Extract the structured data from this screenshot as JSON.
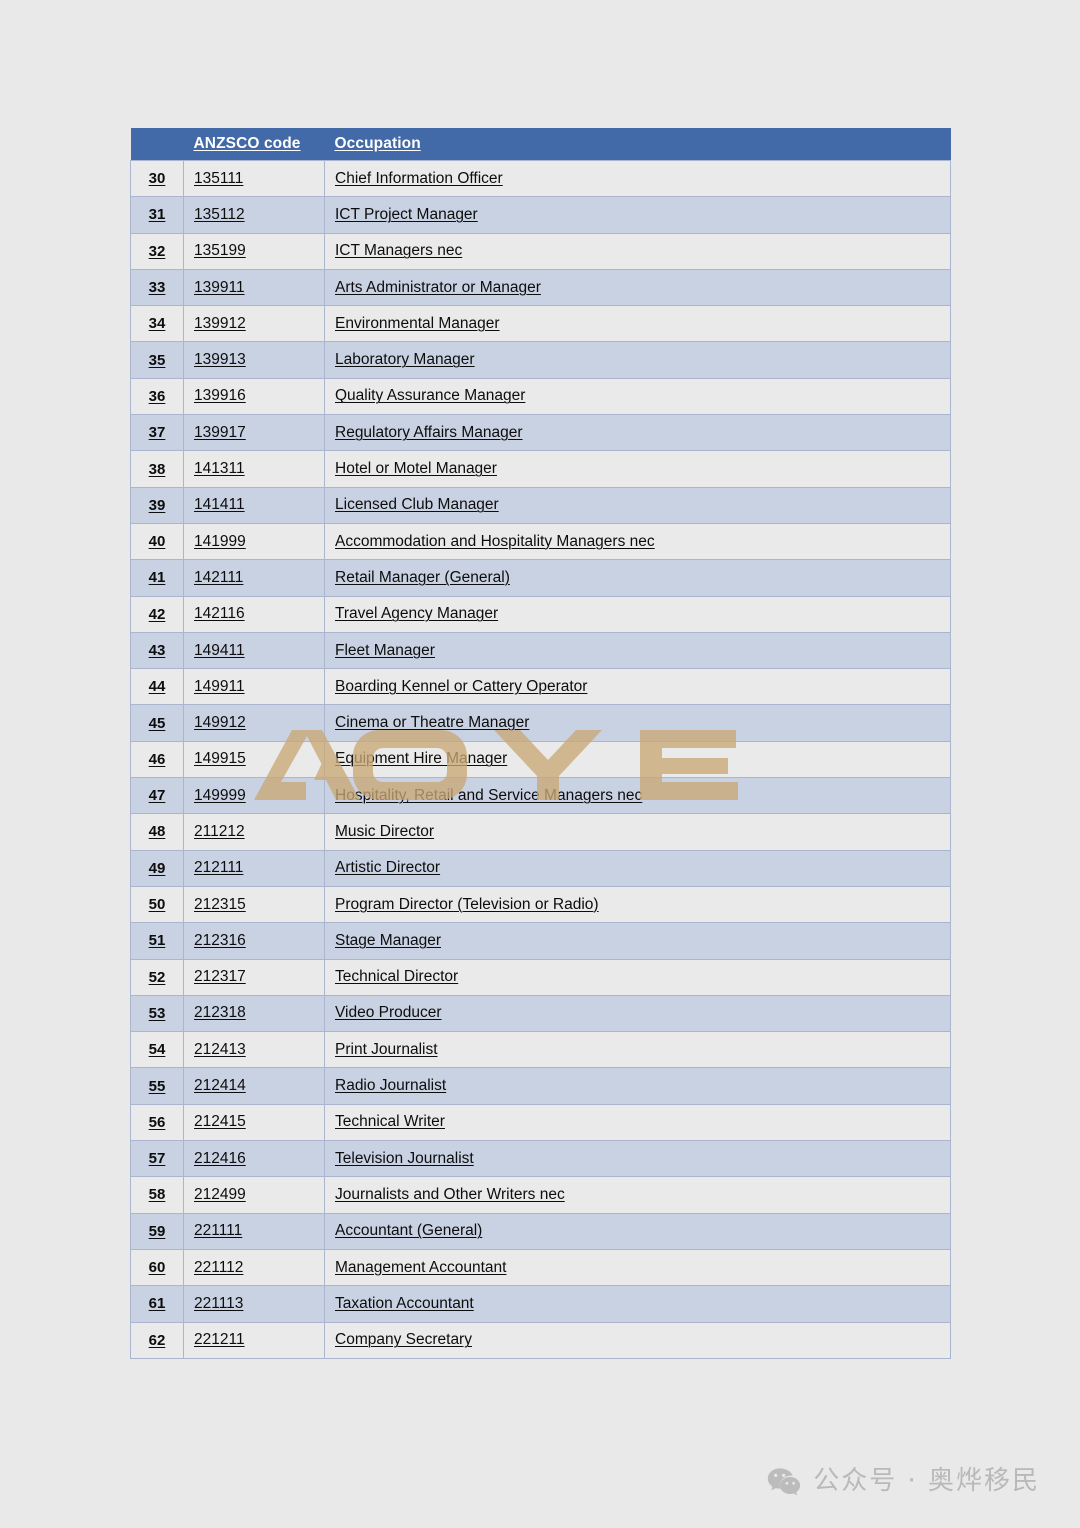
{
  "table": {
    "columns": [
      "",
      "ANZSCO code",
      "Occupation"
    ],
    "header": {
      "num_label": "",
      "code_label": "ANZSCO code",
      "occupation_label": "Occupation"
    },
    "rows": [
      {
        "num": "30",
        "code": "135111",
        "occupation": "Chief Information Officer"
      },
      {
        "num": "31",
        "code": "135112",
        "occupation": "ICT Project Manager"
      },
      {
        "num": "32",
        "code": "135199",
        "occupation": "ICT Managers nec"
      },
      {
        "num": "33",
        "code": "139911",
        "occupation": "Arts Administrator or Manager"
      },
      {
        "num": "34",
        "code": "139912",
        "occupation": "Environmental Manager"
      },
      {
        "num": "35",
        "code": "139913",
        "occupation": "Laboratory Manager"
      },
      {
        "num": "36",
        "code": "139916",
        "occupation": "Quality Assurance Manager"
      },
      {
        "num": "37",
        "code": "139917",
        "occupation": "Regulatory Affairs Manager"
      },
      {
        "num": "38",
        "code": "141311",
        "occupation": "Hotel or Motel Manager"
      },
      {
        "num": "39",
        "code": "141411",
        "occupation": "Licensed Club Manager"
      },
      {
        "num": "40",
        "code": "141999",
        "occupation": "Accommodation and Hospitality Managers nec"
      },
      {
        "num": "41",
        "code": "142111",
        "occupation": "Retail Manager (General)"
      },
      {
        "num": "42",
        "code": "142116",
        "occupation": "Travel Agency Manager"
      },
      {
        "num": "43",
        "code": "149411",
        "occupation": "Fleet Manager"
      },
      {
        "num": "44",
        "code": "149911",
        "occupation": "Boarding Kennel or Cattery Operator"
      },
      {
        "num": "45",
        "code": "149912",
        "occupation": "Cinema or Theatre Manager"
      },
      {
        "num": "46",
        "code": "149915",
        "occupation": "Equipment Hire Manager"
      },
      {
        "num": "47",
        "code": "149999",
        "occupation": "Hospitality, Retail and Service Managers nec"
      },
      {
        "num": "48",
        "code": "211212",
        "occupation": "Music Director"
      },
      {
        "num": "49",
        "code": "212111",
        "occupation": "Artistic Director"
      },
      {
        "num": "50",
        "code": "212315",
        "occupation": "Program Director (Television or Radio)"
      },
      {
        "num": "51",
        "code": "212316",
        "occupation": "Stage Manager"
      },
      {
        "num": "52",
        "code": "212317",
        "occupation": "Technical Director"
      },
      {
        "num": "53",
        "code": "212318",
        "occupation": "Video Producer"
      },
      {
        "num": "54",
        "code": "212413",
        "occupation": "Print Journalist"
      },
      {
        "num": "55",
        "code": "212414",
        "occupation": "Radio Journalist"
      },
      {
        "num": "56",
        "code": "212415",
        "occupation": "Technical Writer"
      },
      {
        "num": "57",
        "code": "212416",
        "occupation": "Television Journalist"
      },
      {
        "num": "58",
        "code": "212499",
        "occupation": "Journalists and Other Writers nec"
      },
      {
        "num": "59",
        "code": "221111",
        "occupation": "Accountant (General)"
      },
      {
        "num": "60",
        "code": "221112",
        "occupation": "Management Accountant"
      },
      {
        "num": "61",
        "code": "221113",
        "occupation": "Taxation Accountant"
      },
      {
        "num": "62",
        "code": "221211",
        "occupation": "Company Secretary"
      }
    ]
  },
  "watermark": {
    "text": "AOYE",
    "color": "#c9a876"
  },
  "footer": {
    "icon": "wechat-logo-icon",
    "text": "公众号 · 奥烨移民",
    "color": "#b9b9b9"
  },
  "colors": {
    "page_background": "#e9e9e9",
    "header_band": "#4269a8",
    "header_text": "#ffffff",
    "row_odd": "#eaeaea",
    "row_even": "#c9d2e3",
    "cell_border": "#a9b6cd",
    "body_text": "#0d0d0d"
  }
}
